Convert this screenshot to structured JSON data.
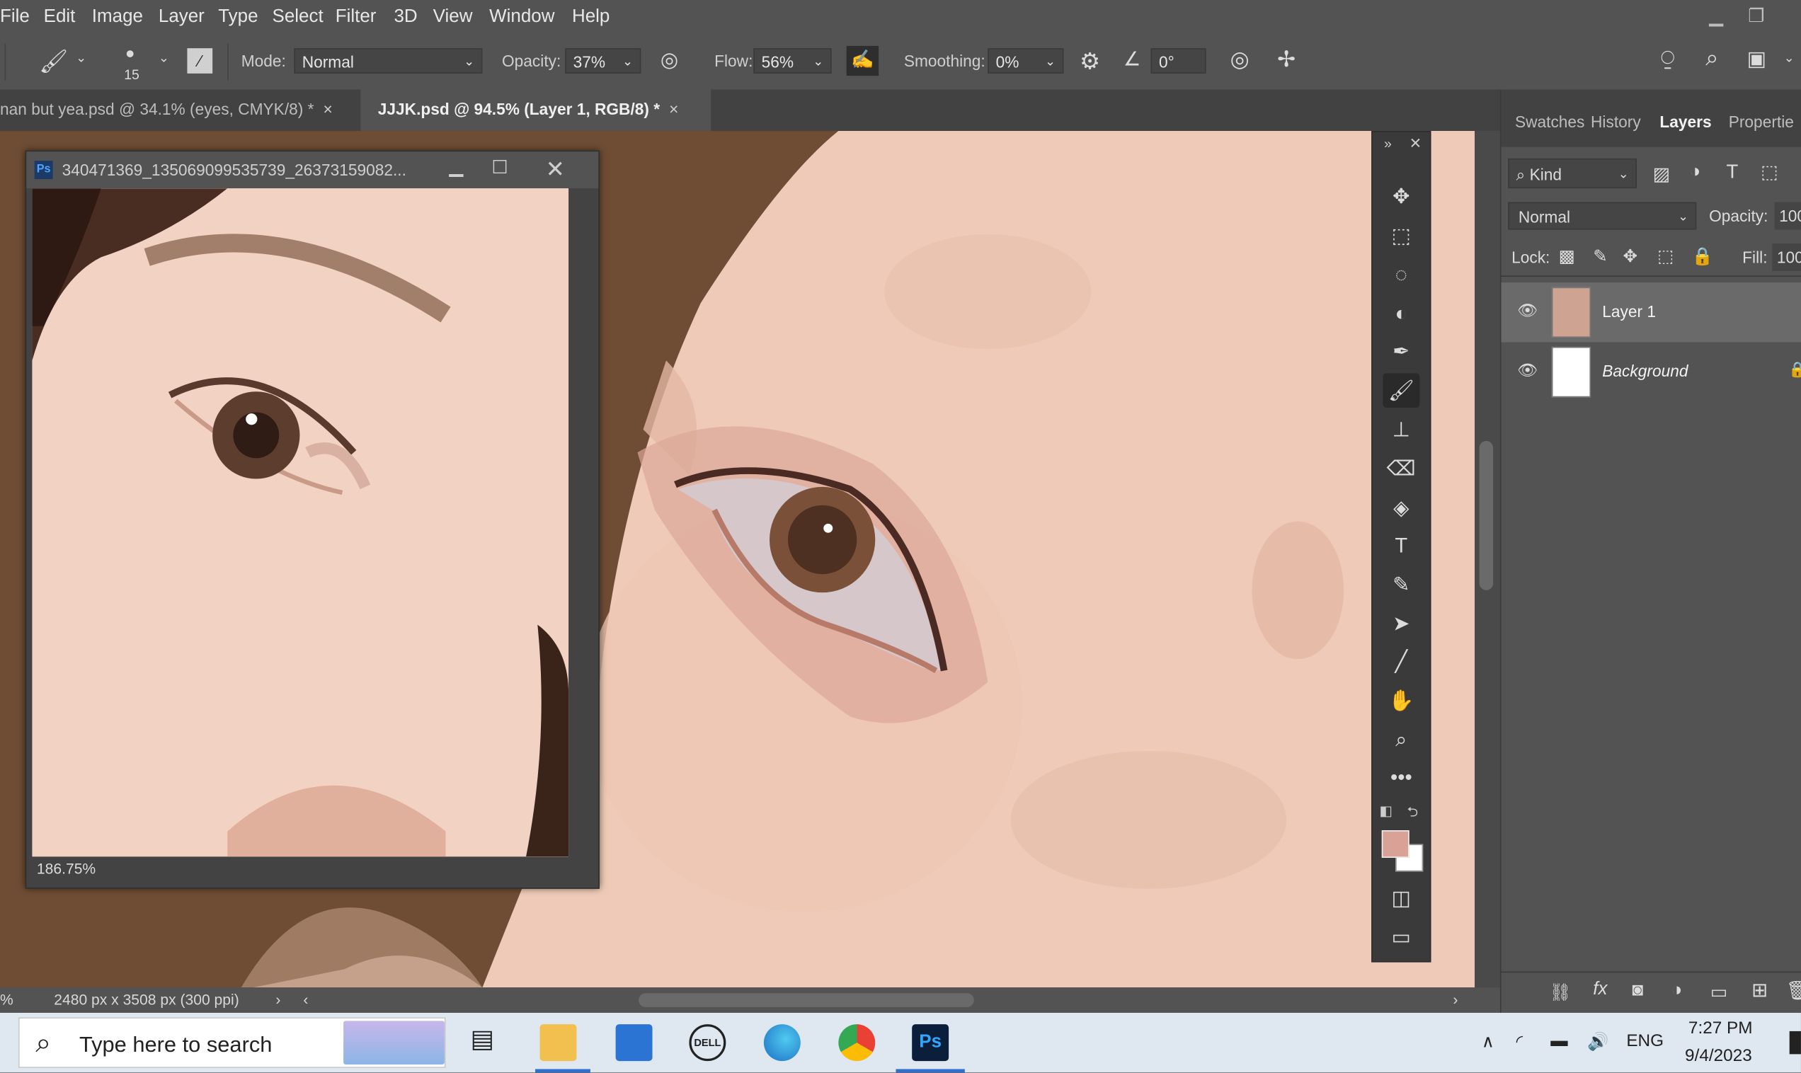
{
  "menu": [
    "File",
    "Edit",
    "Image",
    "Layer",
    "Type",
    "Select",
    "Filter",
    "3D",
    "View",
    "Window",
    "Help"
  ],
  "options": {
    "brush_size": "15",
    "mode_label": "Mode:",
    "mode_value": "Normal",
    "opacity_label": "Opacity:",
    "opacity_value": "37%",
    "flow_label": "Flow:",
    "flow_value": "56%",
    "smoothing_label": "Smoothing:",
    "smoothing_value": "0%",
    "angle_value": "0°"
  },
  "doc_tabs": [
    {
      "label": "nan but yea.psd @ 34.1% (eyes, CMYK/8) *",
      "close": "×"
    },
    {
      "label": "JJJK.psd @ 94.5% (Layer 1, RGB/8) *",
      "close": "×"
    }
  ],
  "reference_window": {
    "title": "340471369_135069099535739_26373159082...",
    "zoom": "186.75%"
  },
  "panel": {
    "tabs": [
      "Swatches",
      "History",
      "Layers",
      "Propertie"
    ],
    "filter_kind": "Kind",
    "blend_mode": "Normal",
    "opacity_label": "Opacity:",
    "opacity_value": "100",
    "lock_label": "Lock:",
    "fill_label": "Fill:",
    "fill_value": "100",
    "layers": [
      {
        "name": "Layer 1"
      },
      {
        "name": "Background"
      }
    ]
  },
  "status": {
    "zoom": "%",
    "doc_size": "2480 px x 3508 px (300 ppi)"
  },
  "taskbar": {
    "search_placeholder": "Type here to search",
    "language": "ENG",
    "time": "7:27 PM",
    "date": "9/4/2023"
  },
  "colors": {
    "foreground": "#d8a297",
    "background": "#ffffff",
    "skin": "#efcab8"
  }
}
